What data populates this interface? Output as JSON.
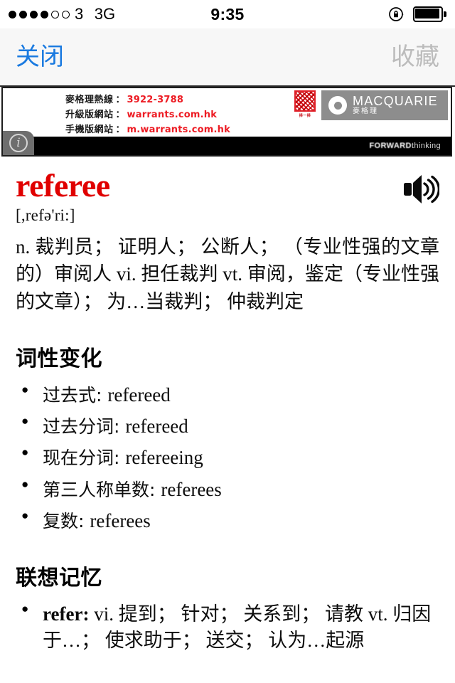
{
  "status_bar": {
    "signal_dots_filled": 4,
    "signal_dots_total": 6,
    "carrier": "3",
    "network": "3G",
    "time": "9:35",
    "rotation_lock_icon": "rotation-lock-icon",
    "battery_icon": "battery-full-icon"
  },
  "navbar": {
    "close_label": "关闭",
    "favorite_label": "收藏",
    "close_color": "#1a7ae0",
    "favorite_color": "#bcbcbc"
  },
  "ad": {
    "lines": [
      {
        "label": "麥格理熱線",
        "value": "3922-3788"
      },
      {
        "label": "升級版網站",
        "value": "warrants.com.hk"
      },
      {
        "label": "手機版網站",
        "value": "m.warrants.com.hk"
      }
    ],
    "colon": "：",
    "brand_name": "MACQUARIE",
    "brand_name_cn": "麥格理",
    "qr_caption": "掃一掃",
    "tagline_bold": "FORWARD",
    "tagline_light": "thinking",
    "info_glyph": "i",
    "accent_color": "#ed1c24"
  },
  "entry": {
    "headword": "referee",
    "headword_color": "#e00000",
    "phonetic": "[,refə'ri:]",
    "speaker_icon": "speaker-icon",
    "definition": "n. 裁判员； 证明人； 公断人； （专业性强的文章的）审阅人 vi. 担任裁判 vt. 审阅，鉴定（专业性强的文章）； 为…当裁判； 仲裁判定"
  },
  "inflections": {
    "title": "词性变化",
    "items": [
      {
        "zh": "过去式: ",
        "en": "refereed"
      },
      {
        "zh": "过去分词: ",
        "en": "refereed"
      },
      {
        "zh": "现在分词: ",
        "en": "refereeing"
      },
      {
        "zh": "第三人称单数: ",
        "en": "referees"
      },
      {
        "zh": "复数: ",
        "en": "referees"
      }
    ]
  },
  "association": {
    "title": "联想记忆",
    "items": [
      {
        "word": "refer:",
        "body": " vi. 提到； 针对； 关系到； 请教 vt. 归因于…； 使求助于； 送交； 认为…起源"
      }
    ]
  }
}
